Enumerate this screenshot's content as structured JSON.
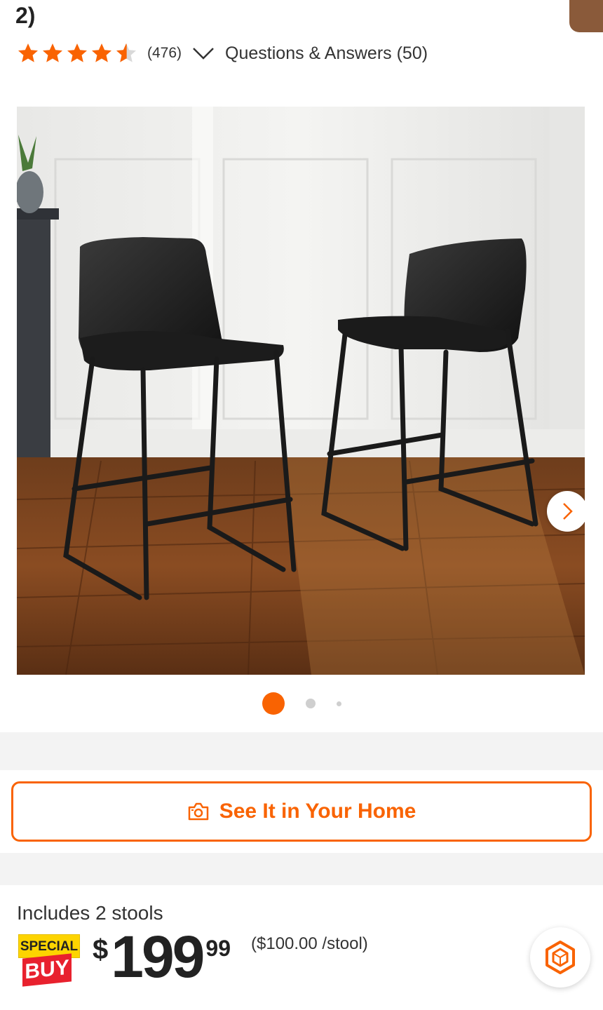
{
  "product": {
    "title_tail": "2)",
    "rating": 4.5,
    "review_count": "(476)",
    "qa_label": "Questions & Answers (50)"
  },
  "gallery": {
    "image_alt": "Two black faux leather bar stools on a wood floor",
    "slide_count": 3,
    "active_slide": 1
  },
  "ar_button": {
    "label": "See It in Your Home"
  },
  "pricing": {
    "includes": "Includes 2 stools",
    "badge_top": "SPECIAL",
    "badge_bottom": "BUY",
    "currency": "$",
    "whole": "199",
    "cents": "99",
    "per_unit": "($100.00 /stool)"
  },
  "colors": {
    "accent": "#f96302",
    "star": "#f96302",
    "badge_yellow": "#fdd400",
    "badge_red": "#e8212e"
  },
  "icons": {
    "star": "star-icon",
    "chevron": "chevron-down-icon",
    "next": "chevron-right-icon",
    "camera": "camera-icon",
    "assistant": "hexagon-assistant-icon"
  }
}
